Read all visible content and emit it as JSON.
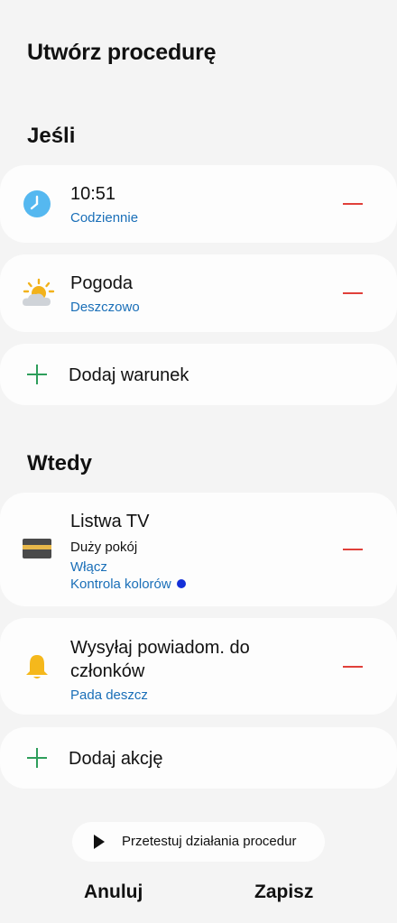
{
  "page": {
    "title": "Utwórz procedurę"
  },
  "if_section": {
    "title": "Jeśli",
    "conditions": [
      {
        "icon": "clock-icon",
        "title": "10:51",
        "subtitle": "Codziennie"
      },
      {
        "icon": "weather-icon",
        "title": "Pogoda",
        "subtitle": "Deszczowo"
      }
    ],
    "add_label": "Dodaj warunek"
  },
  "then_section": {
    "title": "Wtedy",
    "actions": [
      {
        "icon": "tv-strip-icon",
        "title": "Listwa TV",
        "room": "Duży pokój",
        "action": "Włącz",
        "detail": "Kontrola kolorów"
      },
      {
        "icon": "bell-icon",
        "title_line1": "Wysyłaj powiadom. do",
        "title_line2": "członków",
        "subtitle": "Pada deszcz"
      }
    ],
    "add_label": "Dodaj akcję"
  },
  "test_button": {
    "label": "Przetestuj działania procedur"
  },
  "footer": {
    "cancel_label": "Anuluj",
    "save_label": "Zapisz"
  },
  "colors": {
    "accent_blue": "#1a6fb8",
    "remove_red": "#e0403a",
    "add_green": "#2e9e5b",
    "color_dot": "#1430d8"
  }
}
